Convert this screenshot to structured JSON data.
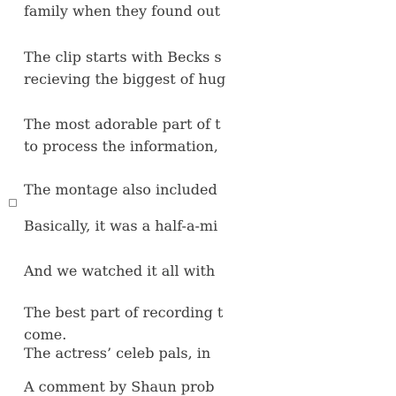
{
  "article": {
    "paragraphs": [
      {
        "lines": [
          "family when they found out"
        ]
      },
      {
        "lines": [
          "The clip starts with Becks s",
          "recieving the biggest of hug"
        ]
      },
      {
        "lines": [
          "The most adorable part of t",
          "to process the information,"
        ]
      },
      {
        "lines": [
          "The montage also included"
        ]
      },
      {
        "lines": [
          "Basically, it was a half-a-mi"
        ]
      },
      {
        "lines": [
          "And we watched it all with"
        ]
      },
      {
        "lines": [
          "The best part of recording t",
          "come."
        ]
      },
      {
        "lines": [
          "The actress’  celeb pals, in"
        ]
      },
      {
        "lines": [
          "A comment by Shaun prob"
        ]
      }
    ]
  },
  "icons": {
    "embed": "image-placeholder-icon"
  }
}
